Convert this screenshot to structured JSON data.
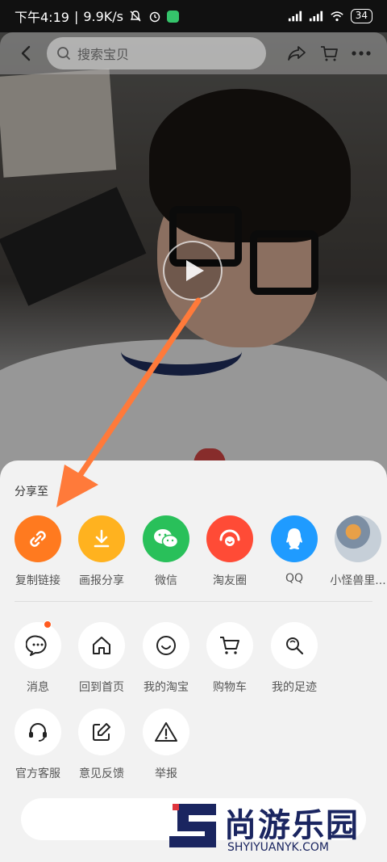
{
  "status_bar": {
    "time": "下午4:19",
    "speed": "9.9K/s",
    "battery": "34"
  },
  "nav": {
    "search_placeholder": "搜索宝贝"
  },
  "share_sheet": {
    "title": "分享至",
    "share_items": [
      {
        "label": "复制链接",
        "icon": "link-icon",
        "color": "#ff7a1f"
      },
      {
        "label": "画报分享",
        "icon": "download-icon",
        "color": "#ffb21f"
      },
      {
        "label": "微信",
        "icon": "wechat-icon",
        "color": "#29c05a"
      },
      {
        "label": "淘友圈",
        "icon": "taoyouquan-icon",
        "color": "#ff4b36"
      },
      {
        "label": "QQ",
        "icon": "qq-icon",
        "color": "#1f9bff"
      },
      {
        "label": "小怪兽里...",
        "icon": "avatar",
        "color": "#a0b4c8"
      }
    ],
    "action_items_row1": [
      {
        "label": "消息",
        "icon": "message-icon"
      },
      {
        "label": "回到首页",
        "icon": "home-icon"
      },
      {
        "label": "我的淘宝",
        "icon": "smile-icon"
      },
      {
        "label": "购物车",
        "icon": "cart-icon"
      },
      {
        "label": "我的足迹",
        "icon": "footprint-icon"
      }
    ],
    "action_items_row2": [
      {
        "label": "官方客服",
        "icon": "headset-icon"
      },
      {
        "label": "意见反馈",
        "icon": "edit-icon"
      },
      {
        "label": "举报",
        "icon": "warning-icon"
      }
    ]
  },
  "watermark": {
    "title": "尚游乐园",
    "subtitle": "SHYIYUANYK.COM"
  }
}
